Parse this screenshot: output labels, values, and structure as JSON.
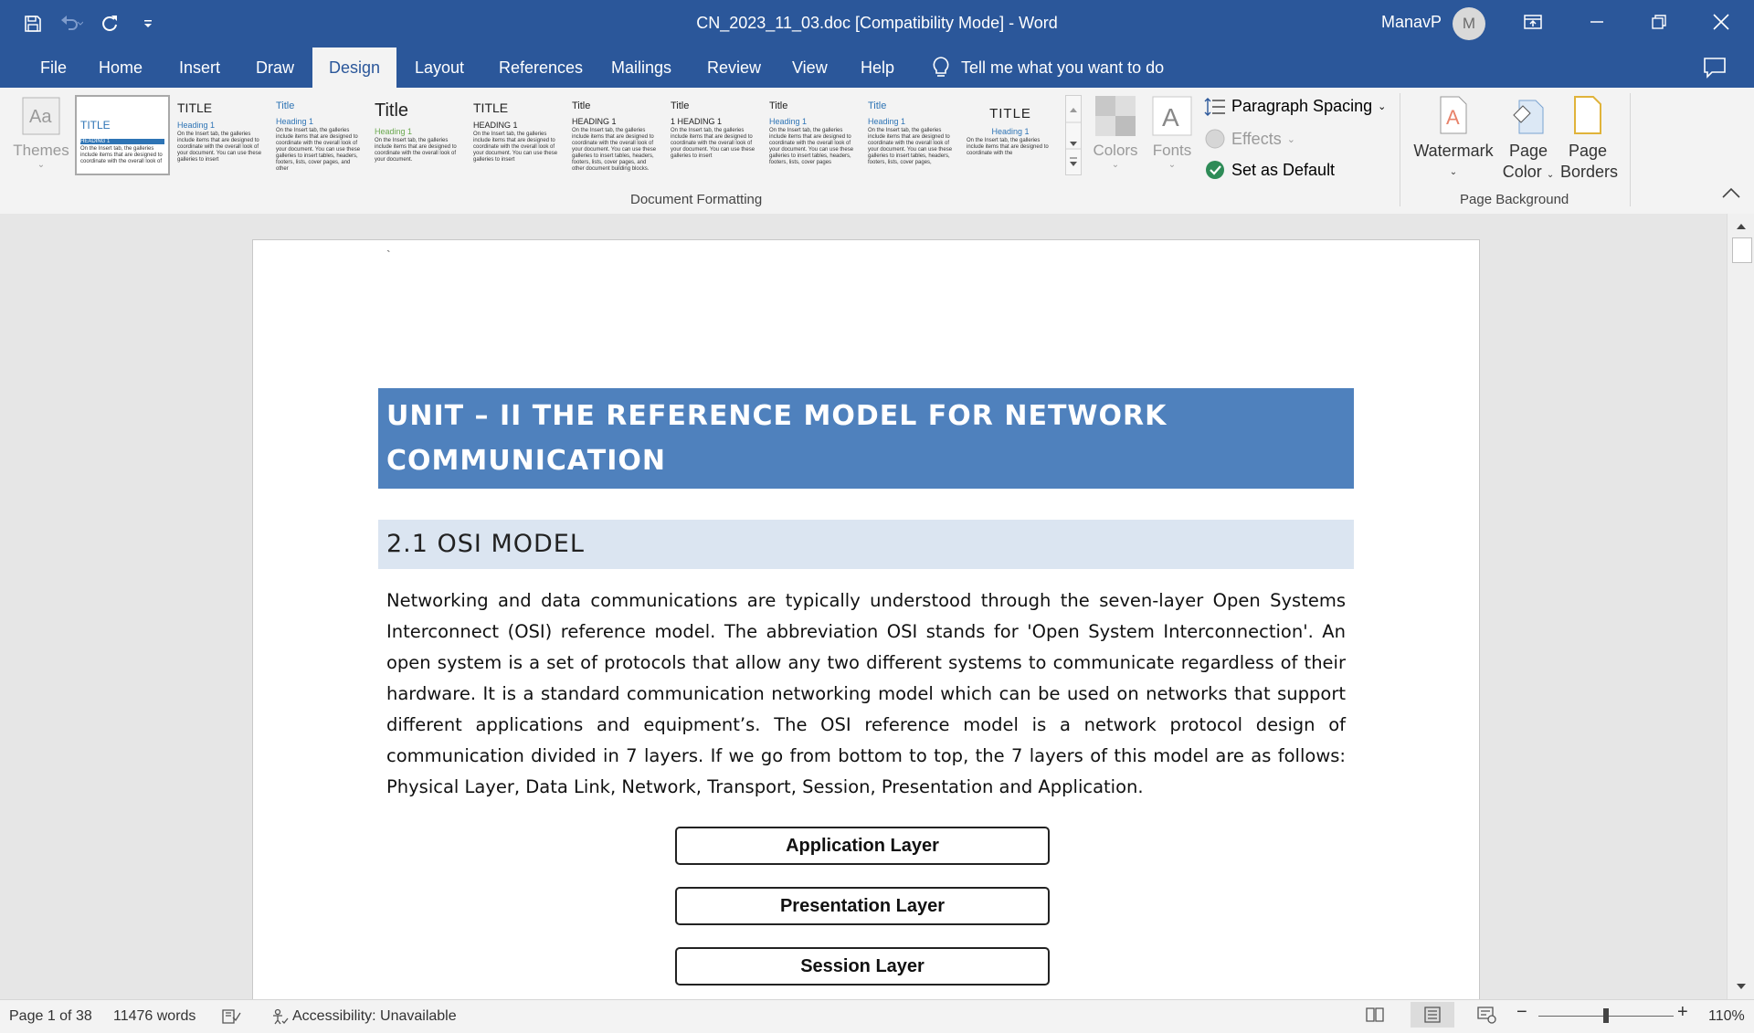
{
  "titlebar": {
    "document_title": "CN_2023_11_03.doc [Compatibility Mode]  -  Word",
    "user_name": "ManavP",
    "avatar_initial": "M"
  },
  "tabs": [
    "File",
    "Home",
    "Insert",
    "Draw",
    "Design",
    "Layout",
    "References",
    "Mailings",
    "Review",
    "View",
    "Help"
  ],
  "active_tab": "Design",
  "tell_me": "Tell me what you want to do",
  "ribbon": {
    "themes_label": "Themes",
    "gallery": [
      {
        "title": "TITLE",
        "heading": "HEADING 1",
        "body": "On the Insert tab, the galleries include items that are designed to coordinate with the overall look of"
      },
      {
        "title": "TITLE",
        "heading": "Heading 1",
        "body": "On the Insert tab, the galleries include items that are designed to coordinate with the overall look of your document. You can use these galleries to insert"
      },
      {
        "title": "Title",
        "heading": "Heading 1",
        "body": "On the Insert tab, the galleries include items that are designed to coordinate with the overall look of your document. You can use these galleries to insert tables, headers, footers, lists, cover pages, and other"
      },
      {
        "title": "Title",
        "heading": "Heading 1",
        "body": "On the Insert tab, the galleries include items that are designed to coordinate with the overall look of your document."
      },
      {
        "title": "TITLE",
        "heading": "HEADING 1",
        "body": "On the Insert tab, the galleries include items that are designed to coordinate with the overall look of your document. You can use these galleries to insert"
      },
      {
        "title": "Title",
        "heading": "HEADING 1",
        "body": "On the Insert tab, the galleries include items that are designed to coordinate with the overall look of your document. You can use these galleries to insert tables, headers, footers, lists, cover pages, and other document building blocks."
      },
      {
        "title": "Title",
        "heading": "1  HEADING 1",
        "body": "On the Insert tab, the galleries include items that are designed to coordinate with the overall look of your document. You can use these galleries to insert"
      },
      {
        "title": "Title",
        "heading": "Heading 1",
        "body": "On the Insert tab, the galleries include items that are designed to coordinate with the overall look of your document. You can use these galleries to insert tables, headers, footers, lists, cover pages"
      },
      {
        "title": "Title",
        "heading": "Heading 1",
        "body": "On the Insert tab, the galleries include items that are designed to coordinate with the overall look of your document. You can use these galleries to insert tables, headers, footers, lists, cover pages,"
      },
      {
        "title": "TITLE",
        "heading": "Heading 1",
        "body": "On the Insert tab, the galleries include items that are designed to coordinate with the"
      }
    ],
    "colors_label": "Colors",
    "fonts_label": "Fonts",
    "paragraph_spacing": "Paragraph Spacing",
    "effects": "Effects",
    "set_as_default": "Set as Default",
    "document_formatting_group": "Document Formatting",
    "watermark": "Watermark",
    "page_color_line1": "Page",
    "page_color_line2": "Color",
    "page_borders_line1": "Page",
    "page_borders_line2": "Borders",
    "page_background_group": "Page Background"
  },
  "document": {
    "backtick": "`",
    "heading1": "UNIT – II THE REFERENCE MODEL FOR NETWORK COMMUNICATION",
    "heading2": "2.1 OSI MODEL",
    "paragraph": "Networking and data communications are typically understood through the seven-layer Open Systems Interconnect (OSI) reference model. The abbreviation OSI stands for 'Open System Interconnection'. An open system is a set of protocols that allow any two different systems to communicate regardless of their hardware. It is a standard communication networking model which can be used on networks that support different applications and equipment’s. The OSI reference model is a network protocol design of communication divided in 7 layers. If we go from bottom to top, the 7 layers of this model are as follows: Physical Layer, Data Link, Network, Transport, Session, Presentation and Application.",
    "layers": [
      "Application Layer",
      "Presentation Layer",
      "Session Layer"
    ]
  },
  "statusbar": {
    "page": "Page 1 of 38",
    "words": "11476 words",
    "accessibility": "Accessibility: Unavailable",
    "zoom": "110%",
    "zoom_fraction": 0.5
  },
  "colors": {
    "brand": "#2b579a",
    "heading1_fill": "#4f81bd",
    "heading2_fill": "#dbe5f1"
  }
}
